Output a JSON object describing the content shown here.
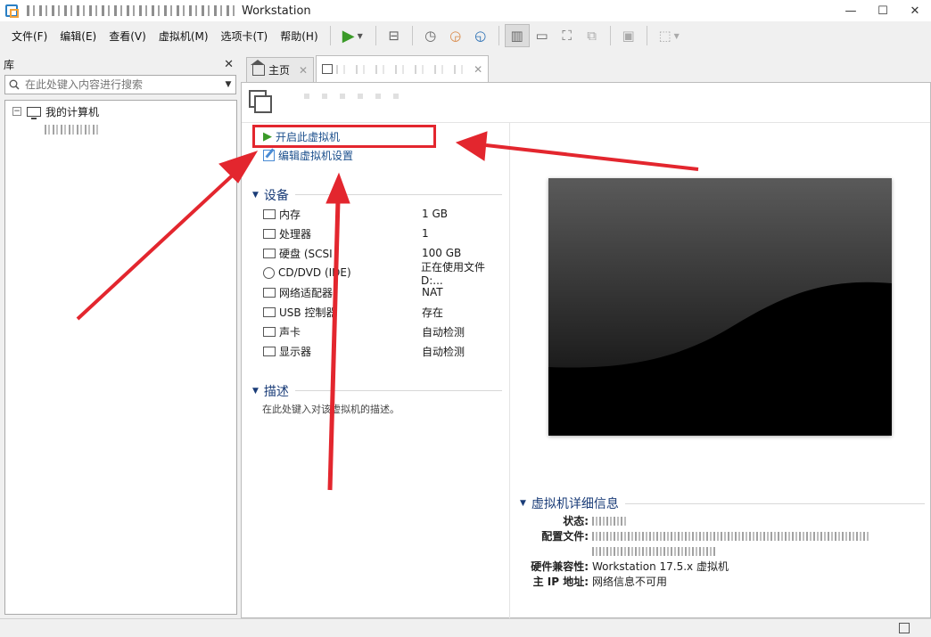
{
  "window": {
    "title": "Workstation",
    "controls": {
      "minimize": "—",
      "maximize": "☐",
      "close": "✕"
    }
  },
  "menu": {
    "items": [
      "文件(F)",
      "编辑(E)",
      "查看(V)",
      "虚拟机(M)",
      "选项卡(T)",
      "帮助(H)"
    ]
  },
  "library": {
    "title": "库",
    "close": "✕",
    "search_placeholder": "在此处键入内容进行搜索",
    "tree": {
      "toggle": "−",
      "root_label": "我的计算机"
    }
  },
  "tabs": {
    "home_label": "主页",
    "close": "✕"
  },
  "actions": {
    "power_on": "开启此虚拟机",
    "edit_settings": "编辑虚拟机设置"
  },
  "devices": {
    "title": "设备",
    "rows": [
      {
        "name": "内存",
        "value": "1 GB",
        "icon": "memory-icon"
      },
      {
        "name": "处理器",
        "value": "1",
        "icon": "cpu-icon"
      },
      {
        "name": "硬盘 (SCSI",
        "value": "100 GB",
        "icon": "hard-disk-icon"
      },
      {
        "name": "CD/DVD (IDE)",
        "value": "正在使用文件 D:...",
        "icon": "cd-dvd-icon"
      },
      {
        "name": "网络适配器",
        "value": "NAT",
        "icon": "network-adapter-icon"
      },
      {
        "name": "USB 控制器",
        "value": "存在",
        "icon": "usb-icon"
      },
      {
        "name": "声卡",
        "value": "自动检测",
        "icon": "sound-card-icon"
      },
      {
        "name": "显示器",
        "value": "自动检测",
        "icon": "display-icon"
      }
    ]
  },
  "description": {
    "title": "描述",
    "placeholder": "在此处键入对该虚拟机的描述。"
  },
  "details": {
    "title": "虚拟机详细信息",
    "state_label": "状态:",
    "config_label": "配置文件:",
    "compat_label": "硬件兼容性:",
    "compat_value": "Workstation 17.5.x 虚拟机",
    "ip_label": "主 IP 地址:",
    "ip_value": "网络信息不可用"
  },
  "annotation_color": "#e3262e"
}
